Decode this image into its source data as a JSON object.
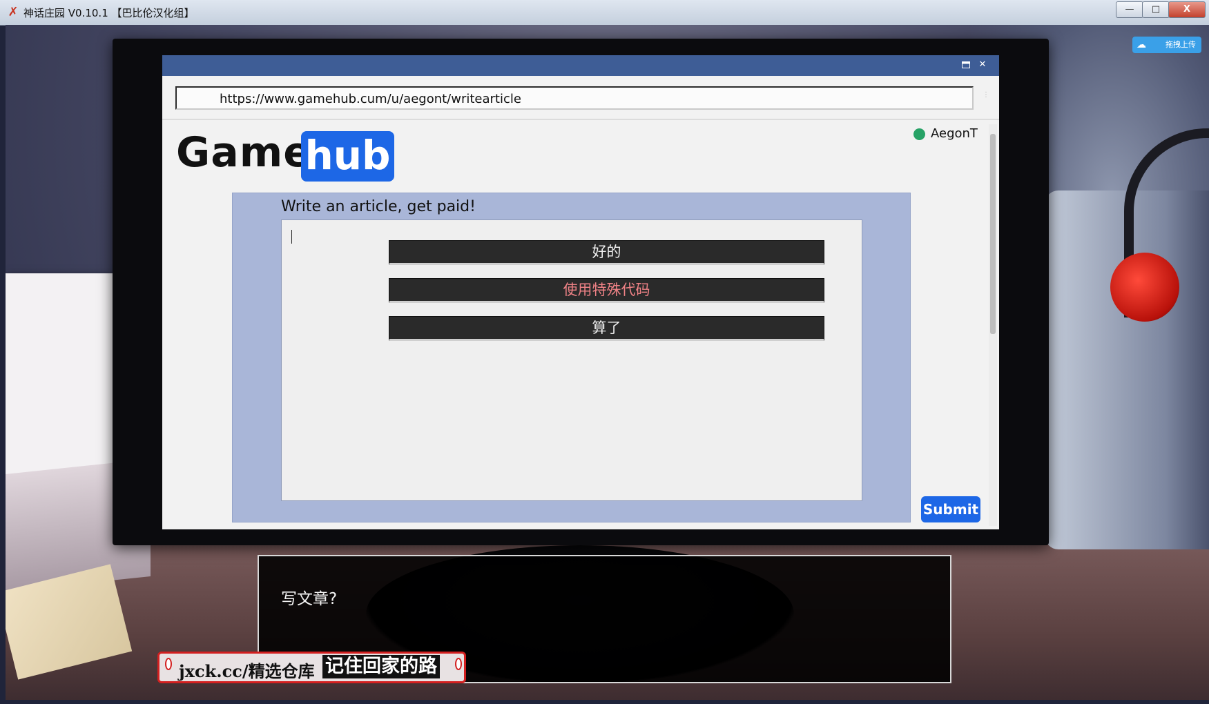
{
  "window": {
    "title": "神话庄园 V0.10.1 【巴比伦汉化组】",
    "app_icon": "game-logo-icon",
    "minimize_glyph": "—",
    "maximize_glyph": "□",
    "close_glyph": "X"
  },
  "cloud_upload": {
    "label": "拖拽上传",
    "icon": "cloud-icon"
  },
  "browser": {
    "url": "https://www.gamehub.cum/u/aegont/writearticle",
    "logo_left": "Game",
    "logo_right": "hub",
    "user": {
      "name": "AegonT",
      "status_color": "#27a266"
    },
    "heading": "Write an article, get paid!",
    "submit_label": "Submit",
    "colors": {
      "titlebar": "#3e5d96",
      "brand": "#1d67e6",
      "panel": "#a9b6d8"
    }
  },
  "choices": [
    {
      "label": "好的",
      "color": "#f0f0f0"
    },
    {
      "label": "使用特殊代码",
      "color": "#ef8286"
    },
    {
      "label": "算了",
      "color": "#f0f0f0"
    }
  ],
  "dialogue": {
    "text": "写文章?"
  },
  "watermark": {
    "part1": "jxck.cc/精选仓库",
    "part2": "记住回家的路"
  }
}
